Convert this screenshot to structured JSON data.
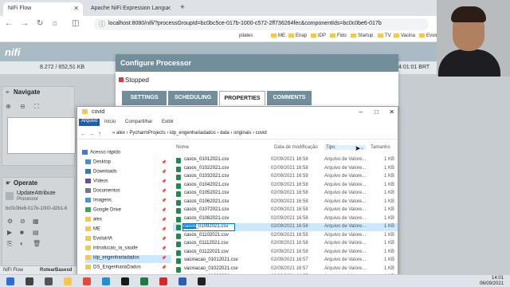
{
  "browser": {
    "tabs": [
      {
        "label": "NiFi Flow",
        "active": true
      },
      {
        "label": "Apache NiFi Expression Langu",
        "active": false
      }
    ],
    "new_tab": "+",
    "url": "localhost:8080/nifi/?processGroupId=bc0bc5ce-017b-1000-c572-2ff736264fec&componentIds=bc0c0be6-017b",
    "bookmarks": [
      "pilates",
      "ME",
      "Enap",
      "IDP",
      "Fido",
      "Startup",
      "TV",
      "Vacina",
      "EvoluirIA"
    ]
  },
  "nifi": {
    "status_values": "8.272 / 652,51 KB",
    "clock": "4:01:01 BRT",
    "navigate_title": "Navigate",
    "operate_title": "Operate",
    "operate_component": "UpdateAttribute",
    "operate_type": "Processor",
    "operate_id": "bc0c0be6-017b-1000-d2b1-6",
    "breadcrumb": "NiFi Flow",
    "breadcrumb_sub": "RotearBasesd"
  },
  "configure": {
    "title": "Configure Processor",
    "status": "Stopped",
    "tabs": [
      "SETTINGS",
      "SCHEDULING",
      "PROPERTIES",
      "COMMENTS"
    ],
    "active_tab": "PROPERTIES"
  },
  "explorer": {
    "title": "covid",
    "ribbon": [
      "Arquivo",
      "Início",
      "Compartilhar",
      "Exibir"
    ],
    "path": [
      "alex",
      "PycharmProjects",
      "idp_engenhariadados",
      "data",
      "originais",
      "covid"
    ],
    "path_text": "«  alex  ›  PycharmProjects  ›  idp_engenhariadados  ›  data  ›  originais  ›  covid",
    "nav": [
      {
        "label": "Acesso rápido",
        "color": "#3a7fd5"
      },
      {
        "label": "Desktop",
        "color": "#3b8fd9"
      },
      {
        "label": "Downloads",
        "color": "#2b79c7"
      },
      {
        "label": "Vídeos",
        "color": "#6c4aa8"
      },
      {
        "label": "Documentos",
        "color": "#6d7b8a"
      },
      {
        "label": "Imagens",
        "color": "#3f9ad7"
      },
      {
        "label": "Google Drive",
        "color": "#36a853"
      },
      {
        "label": "alex",
        "color": "#f6c64d"
      },
      {
        "label": "ME",
        "color": "#f6c64d"
      },
      {
        "label": "EvoluirIA",
        "color": "#f6c64d"
      },
      {
        "label": "introducao_ia_saude",
        "color": "#f6c64d"
      },
      {
        "label": "idp_engenhariadados",
        "color": "#f6c64d",
        "selected": true
      },
      {
        "label": "DS_EngenhariaDados",
        "color": "#f6c64d"
      },
      {
        "label": "pandemiamg",
        "color": "#f6c64d"
      }
    ],
    "columns": [
      "Nome",
      "Data de modificação",
      "Tipo",
      "Tamanho"
    ],
    "sorted_column": "Tipo",
    "files": [
      {
        "name": "casos_01012021.csv",
        "date": "02/09/2021 16:58",
        "type": "Arquivo de Valore...",
        "size": "1 KB"
      },
      {
        "name": "casos_01022021.csv",
        "date": "02/09/2021 16:58",
        "type": "Arquivo de Valore...",
        "size": "1 KB"
      },
      {
        "name": "casos_01032021.csv",
        "date": "02/09/2021 16:58",
        "type": "Arquivo de Valore...",
        "size": "1 KB"
      },
      {
        "name": "casos_01042021.csv",
        "date": "02/09/2021 16:58",
        "type": "Arquivo de Valore...",
        "size": "1 KB"
      },
      {
        "name": "casos_01052021.csv",
        "date": "02/09/2021 16:58",
        "type": "Arquivo de Valore...",
        "size": "1 KB"
      },
      {
        "name": "casos_01062021.csv",
        "date": "02/09/2021 16:58",
        "type": "Arquivo de Valore...",
        "size": "1 KB"
      },
      {
        "name": "casos_01072021.csv",
        "date": "02/09/2021 16:58",
        "type": "Arquivo de Valore...",
        "size": "1 KB"
      },
      {
        "name": "casos_01082021.csv",
        "date": "02/09/2021 16:58",
        "type": "Arquivo de Valore...",
        "size": "1 KB"
      },
      {
        "name": "casos_01092021.csv",
        "date": "02/09/2021 16:58",
        "type": "Arquivo de Valore...",
        "size": "1 KB",
        "selected": true,
        "edit_highlight": "casos",
        "edit_rest": "_01092021.csv"
      },
      {
        "name": "casos_01102021.csv",
        "date": "02/09/2021 16:58",
        "type": "Arquivo de Valore...",
        "size": "1 KB"
      },
      {
        "name": "casos_01112021.csv",
        "date": "02/09/2021 16:58",
        "type": "Arquivo de Valore...",
        "size": "1 KB"
      },
      {
        "name": "casos_01122021.csv",
        "date": "02/09/2021 16:58",
        "type": "Arquivo de Valore...",
        "size": "1 KB"
      },
      {
        "name": "vacinacao_01012021.csv",
        "date": "02/09/2021 16:57",
        "type": "Arquivo de Valore...",
        "size": "1 KB"
      },
      {
        "name": "vacinacao_01022021.csv",
        "date": "02/09/2021 16:57",
        "type": "Arquivo de Valore...",
        "size": "1 KB"
      },
      {
        "name": "vacinacao_01032021.csv",
        "date": "02/09/2021 16:57",
        "type": "Arquivo de Valore...",
        "size": "1 KB"
      }
    ]
  },
  "taskbar": {
    "time": "14:01",
    "date": "06/09/2021",
    "apps": [
      {
        "name": "windows-start-icon",
        "color": "#2b6cd6"
      },
      {
        "name": "search-icon",
        "color": "#444444"
      },
      {
        "name": "task-view-icon",
        "color": "#555555"
      },
      {
        "name": "file-explorer-icon",
        "color": "#f6c64d"
      },
      {
        "name": "chrome-icon",
        "color": "#e24a3b"
      },
      {
        "name": "edge-icon",
        "color": "#1f8fd6"
      },
      {
        "name": "pycharm-icon",
        "color": "#1b1b1b"
      },
      {
        "name": "excel-icon",
        "color": "#1f7a43"
      },
      {
        "name": "acrobat-icon",
        "color": "#d42a2a"
      },
      {
        "name": "word-icon",
        "color": "#2b5fb4"
      },
      {
        "name": "terminal-icon",
        "color": "#222222"
      }
    ]
  }
}
